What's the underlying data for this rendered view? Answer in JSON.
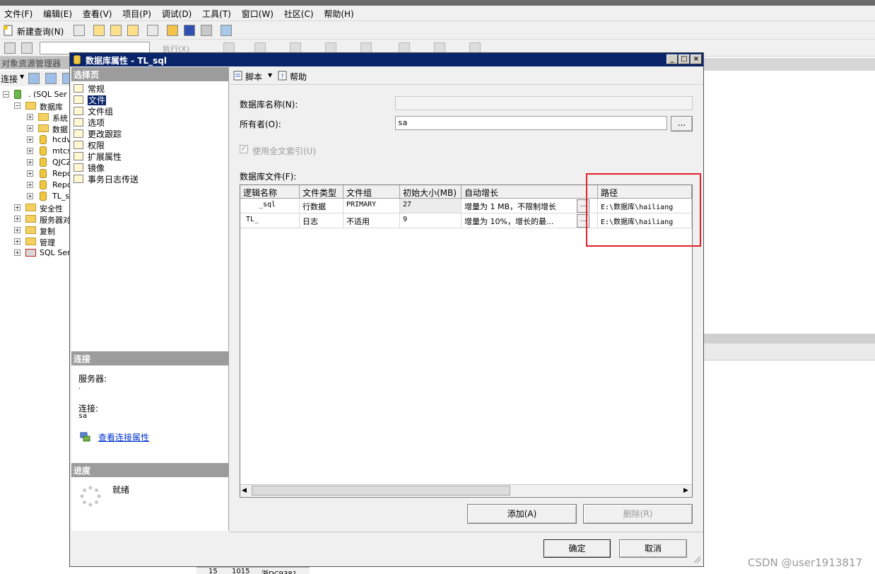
{
  "app": {
    "title_bar_text": ""
  },
  "menu": [
    "文件(F)",
    "编辑(E)",
    "查看(V)",
    "项目(P)",
    "调试(D)",
    "工具(T)",
    "窗口(W)",
    "社区(C)",
    "帮助(H)"
  ],
  "toolbar": {
    "new_query": "新建查询(N)",
    "execute": "执行(X)"
  },
  "object_explorer": {
    "title": "对象资源管理器",
    "connect_label": "连接",
    "tree": [
      {
        "label": ".  (SQL Ser",
        "level": 0,
        "icon": "server-icon",
        "expanded": true
      },
      {
        "label": "数据库",
        "level": 1,
        "icon": "folder-icon",
        "expanded": true
      },
      {
        "label": "系统",
        "level": 2,
        "icon": "folder-icon"
      },
      {
        "label": "数据",
        "level": 2,
        "icon": "folder-icon"
      },
      {
        "label": "hcdv",
        "level": 2,
        "icon": "database-icon"
      },
      {
        "label": "mtcs",
        "level": 2,
        "icon": "database-icon"
      },
      {
        "label": "QJCZ",
        "level": 2,
        "icon": "database-icon"
      },
      {
        "label": "Repo",
        "level": 2,
        "icon": "database-icon"
      },
      {
        "label": "Repo",
        "level": 2,
        "icon": "database-icon"
      },
      {
        "label": "TL_s",
        "level": 2,
        "icon": "database-icon"
      },
      {
        "label": "安全性",
        "level": 1,
        "icon": "folder-icon"
      },
      {
        "label": "服务器对",
        "level": 1,
        "icon": "folder-icon"
      },
      {
        "label": "复制",
        "level": 1,
        "icon": "folder-icon"
      },
      {
        "label": "管理",
        "level": 1,
        "icon": "folder-icon"
      },
      {
        "label": "SQL Ser",
        "level": 1,
        "icon": "agent-icon"
      }
    ]
  },
  "dialog": {
    "title": "数据库属性 - TL_sql",
    "select_page_header": "选择页",
    "pages": [
      "常规",
      "文件",
      "文件组",
      "选项",
      "更改跟踪",
      "权限",
      "扩展属性",
      "镜像",
      "事务日志传送"
    ],
    "selected_page": "文件",
    "connection_header": "连接",
    "server_label": "服务器:",
    "server_value": ".",
    "connection_label": "连接:",
    "connection_value": "sa",
    "view_connection_link": "查看连接属性",
    "progress_header": "进度",
    "progress_status": "就绪",
    "script_button": "脚本",
    "help_button": "帮助",
    "db_name_label": "数据库名称(N):",
    "db_name_value": "",
    "owner_label": "所有者(O):",
    "owner_value": "sa",
    "fulltext_label": "使用全文索引(U)",
    "fulltext_checked": true,
    "files_label": "数据库文件(F):",
    "columns": [
      "逻辑名称",
      "文件类型",
      "文件组",
      "初始大小(MB)",
      "自动增长",
      "路径"
    ],
    "rows": [
      {
        "logical": "_sql",
        "type": "行数据",
        "group": "PRIMARY",
        "size": "27",
        "growth": "增量为 1 MB，不限制增长",
        "path": "E:\\数据库\\hailiang"
      },
      {
        "logical": "TL_",
        "type": "日志",
        "group": "不适用",
        "size": "9",
        "growth": "增量为 10%，增长的最...",
        "path": "E:\\数据库\\hailiang"
      }
    ],
    "add_button": "添加(A)",
    "remove_button": "删除(R)",
    "ok_button": "确定",
    "cancel_button": "取消",
    "ellipsis": "...",
    "minimize": "_",
    "maximize": "□",
    "close": "×"
  },
  "status_strip": [
    "15",
    "1015",
    "浙DC9381"
  ],
  "watermark": "CSDN @user1913817",
  "colors": {
    "title_bar": "#0a246a",
    "highlight_box": "#e0202a",
    "section_header": "#9c9c9c"
  }
}
